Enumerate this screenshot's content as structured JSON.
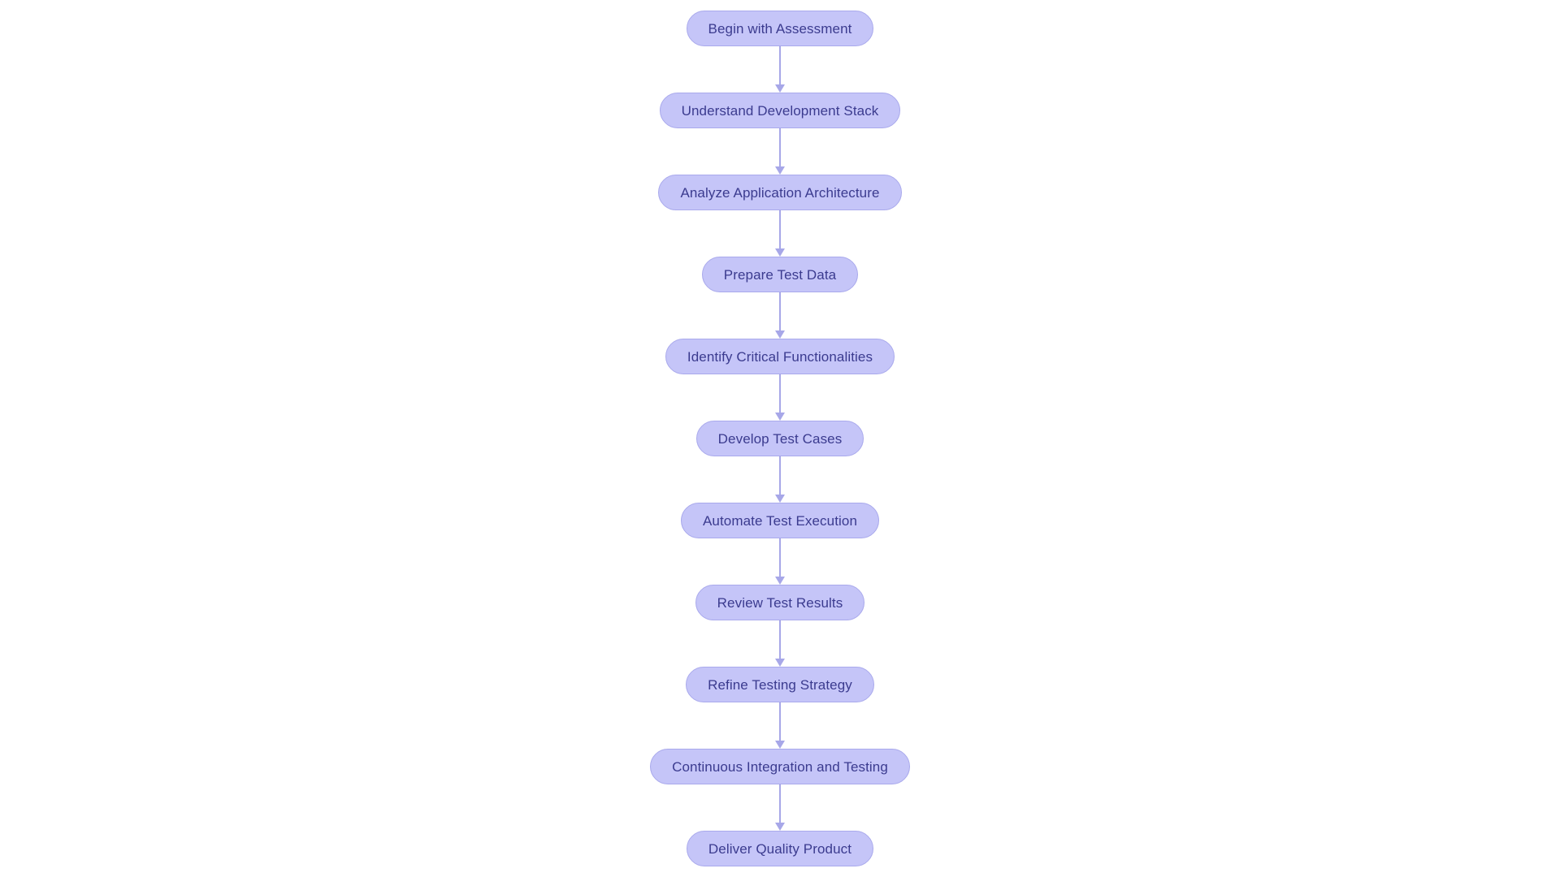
{
  "diagram": {
    "type": "flowchart",
    "orientation": "top-to-bottom",
    "title": "",
    "colors": {
      "node_fill": "#c5c5f8",
      "node_border": "#a9a9ec",
      "node_text": "#3b3b8f",
      "connector": "#a7a7e8",
      "background": "#ffffff"
    },
    "nodes": [
      {
        "id": "n1",
        "label": "Begin with Assessment"
      },
      {
        "id": "n2",
        "label": "Understand Development Stack"
      },
      {
        "id": "n3",
        "label": "Analyze Application Architecture"
      },
      {
        "id": "n4",
        "label": "Prepare Test Data"
      },
      {
        "id": "n5",
        "label": "Identify Critical Functionalities"
      },
      {
        "id": "n6",
        "label": "Develop Test Cases"
      },
      {
        "id": "n7",
        "label": "Automate Test Execution"
      },
      {
        "id": "n8",
        "label": "Review Test Results"
      },
      {
        "id": "n9",
        "label": "Refine Testing Strategy"
      },
      {
        "id": "n10",
        "label": "Continuous Integration and Testing"
      },
      {
        "id": "n11",
        "label": "Deliver Quality Product"
      }
    ],
    "edges": [
      {
        "from": "n1",
        "to": "n2",
        "label": ""
      },
      {
        "from": "n2",
        "to": "n3",
        "label": ""
      },
      {
        "from": "n3",
        "to": "n4",
        "label": ""
      },
      {
        "from": "n4",
        "to": "n5",
        "label": ""
      },
      {
        "from": "n5",
        "to": "n6",
        "label": ""
      },
      {
        "from": "n6",
        "to": "n7",
        "label": ""
      },
      {
        "from": "n7",
        "to": "n8",
        "label": ""
      },
      {
        "from": "n8",
        "to": "n9",
        "label": ""
      },
      {
        "from": "n9",
        "to": "n10",
        "label": ""
      },
      {
        "from": "n10",
        "to": "n11",
        "label": ""
      }
    ]
  }
}
